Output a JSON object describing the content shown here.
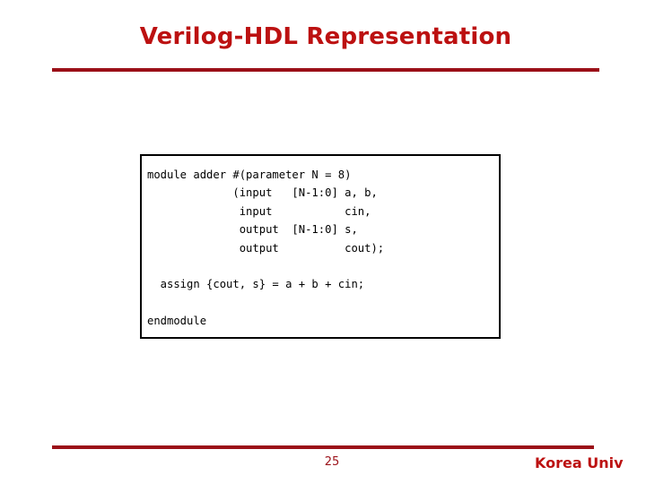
{
  "slide": {
    "title": "Verilog-HDL Representation",
    "page_number": "25",
    "organization": "Korea Univ",
    "colors": {
      "title_red": "#bc1111",
      "rule_red": "#9b1018",
      "code_border": "#000000",
      "background": "#ffffff",
      "code_text": "#000000"
    }
  },
  "code_block": {
    "language": "verilog",
    "lines": [
      "module adder #(parameter N = 8)",
      "             (input   [N-1:0] a, b,",
      "              input           cin,",
      "              output  [N-1:0] s,",
      "              output          cout);",
      "",
      "  assign {cout, s} = a + b + cin;",
      "",
      "endmodule"
    ],
    "text": "module adder #(parameter N = 8)\n             (input   [N-1:0] a, b,\n              input           cin,\n              output  [N-1:0] s,\n              output          cout);\n\n  assign {cout, s} = a + b + cin;\n\nendmodule"
  }
}
